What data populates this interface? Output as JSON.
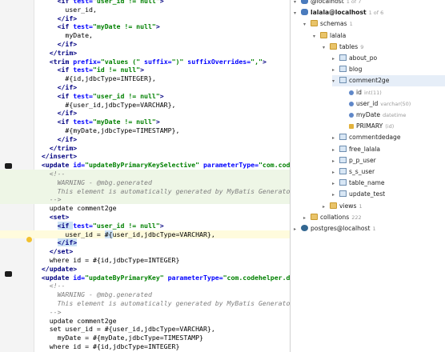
{
  "editor": {
    "lines": [
      {
        "n": "",
        "parts": [
          [
            "      ",
            ""
          ],
          [
            "<if ",
            "t"
          ],
          [
            "test=",
            "a"
          ],
          [
            "\"user_id != null\"",
            "v"
          ],
          [
            ">",
            "t"
          ]
        ]
      },
      {
        "n": "",
        "parts": [
          [
            "        user_id,",
            ""
          ]
        ]
      },
      {
        "n": "",
        "parts": [
          [
            "      ",
            ""
          ],
          [
            "</if>",
            "t"
          ]
        ]
      },
      {
        "n": "",
        "parts": [
          [
            "      ",
            ""
          ],
          [
            "<if ",
            "t"
          ],
          [
            "test=",
            "a"
          ],
          [
            "\"myDate != null\"",
            "v"
          ],
          [
            ">",
            "t"
          ]
        ]
      },
      {
        "n": "",
        "parts": [
          [
            "        myDate,",
            ""
          ]
        ]
      },
      {
        "n": "",
        "parts": [
          [
            "      ",
            ""
          ],
          [
            "</if>",
            "t"
          ]
        ]
      },
      {
        "n": "",
        "parts": [
          [
            "    ",
            ""
          ],
          [
            "</trim>",
            "t"
          ]
        ]
      },
      {
        "n": "",
        "parts": [
          [
            "    ",
            ""
          ],
          [
            "<trim ",
            "t"
          ],
          [
            "prefix=",
            "a"
          ],
          [
            "\"values (\" ",
            "v"
          ],
          [
            "suffix=",
            "a"
          ],
          [
            "\")\" ",
            "v"
          ],
          [
            "suffixOverrides=",
            "a"
          ],
          [
            "\",\"",
            "v"
          ],
          [
            ">",
            "t"
          ]
        ]
      },
      {
        "n": "",
        "parts": [
          [
            "      ",
            ""
          ],
          [
            "<if ",
            "t"
          ],
          [
            "test=",
            "a"
          ],
          [
            "\"id != null\"",
            "v"
          ],
          [
            ">",
            "t"
          ]
        ]
      },
      {
        "n": "",
        "parts": [
          [
            "        #{id,jdbcType=INTEGER},",
            ""
          ]
        ]
      },
      {
        "n": "",
        "parts": [
          [
            "      ",
            ""
          ],
          [
            "</if>",
            "t"
          ]
        ]
      },
      {
        "n": "",
        "parts": [
          [
            "      ",
            ""
          ],
          [
            "<if ",
            "t"
          ],
          [
            "test=",
            "a"
          ],
          [
            "\"user_id != null\"",
            "v"
          ],
          [
            ">",
            "t"
          ]
        ]
      },
      {
        "n": "",
        "parts": [
          [
            "        #{user_id,jdbcType=VARCHAR},",
            ""
          ]
        ]
      },
      {
        "n": "",
        "parts": [
          [
            "      ",
            ""
          ],
          [
            "</if>",
            "t"
          ]
        ]
      },
      {
        "n": "",
        "parts": [
          [
            "      ",
            ""
          ],
          [
            "<if ",
            "t"
          ],
          [
            "test=",
            "a"
          ],
          [
            "\"myDate != null\"",
            "v"
          ],
          [
            ">",
            "t"
          ]
        ]
      },
      {
        "n": "",
        "parts": [
          [
            "        #{myDate,jdbcType=TIMESTAMP},",
            ""
          ]
        ]
      },
      {
        "n": "",
        "parts": [
          [
            "      ",
            ""
          ],
          [
            "</if>",
            "t"
          ]
        ]
      },
      {
        "n": "",
        "parts": [
          [
            "    ",
            ""
          ],
          [
            "</trim>",
            "t"
          ]
        ]
      },
      {
        "n": "",
        "parts": [
          [
            "  ",
            ""
          ],
          [
            "</insert>",
            "t"
          ]
        ]
      },
      {
        "n": "",
        "parts": [
          [
            "  ",
            ""
          ],
          [
            "<update ",
            "t"
          ],
          [
            "id=",
            "a"
          ],
          [
            "\"updateByPrimaryKeySelective\" ",
            "v"
          ],
          [
            "parameterType=",
            "a"
          ],
          [
            "\"com.codehe",
            "v"
          ]
        ]
      },
      {
        "n": "",
        "hl": "green",
        "parts": [
          [
            "    ",
            ""
          ],
          [
            "<!--",
            "c"
          ]
        ]
      },
      {
        "n": "",
        "hl": "green",
        "parts": [
          [
            "      WARNING - @mbg.generated",
            "c"
          ]
        ]
      },
      {
        "n": "",
        "hl": "green",
        "parts": [
          [
            "      This element is automatically generated by MyBatis Generator,",
            "c"
          ]
        ]
      },
      {
        "n": "",
        "hl": "green",
        "parts": [
          [
            "    -->",
            "c"
          ]
        ]
      },
      {
        "n": "",
        "parts": [
          [
            "    update comment2ge",
            ""
          ]
        ]
      },
      {
        "n": "",
        "parts": [
          [
            "    ",
            ""
          ],
          [
            "<set>",
            "t"
          ]
        ]
      },
      {
        "n": "",
        "parts": [
          [
            "      ",
            ""
          ],
          [
            "<if ",
            "t sel"
          ],
          [
            "test=",
            "a"
          ],
          [
            "\"user_id != null\"",
            "v"
          ],
          [
            ">",
            "t"
          ]
        ]
      },
      {
        "n": "",
        "hl": "yellow",
        "parts": [
          [
            "        user_id = ",
            ""
          ],
          [
            "#{",
            "sel"
          ],
          [
            "user_id,jdbcType=VARCHAR}",
            ""
          ],
          [
            ",",
            ""
          ]
        ]
      },
      {
        "n": "",
        "parts": [
          [
            "      ",
            ""
          ],
          [
            "</if>",
            "t sel"
          ]
        ]
      },
      {
        "n": "",
        "parts": [
          [
            "    ",
            ""
          ],
          [
            "</set>",
            "t"
          ]
        ]
      },
      {
        "n": "",
        "parts": [
          [
            "    where id = #{id,jdbcType=INTEGER}",
            ""
          ]
        ]
      },
      {
        "n": "",
        "parts": [
          [
            "  ",
            ""
          ],
          [
            "</update>",
            "t"
          ]
        ]
      },
      {
        "n": "",
        "parts": [
          [
            "  ",
            ""
          ],
          [
            "<update ",
            "t"
          ],
          [
            "id=",
            "a"
          ],
          [
            "\"updateByPrimaryKey\" ",
            "v"
          ],
          [
            "parameterType=",
            "a"
          ],
          [
            "\"com.codehelper.dom",
            "v"
          ]
        ]
      },
      {
        "n": "",
        "parts": [
          [
            "    ",
            ""
          ],
          [
            "<!--",
            "c"
          ]
        ]
      },
      {
        "n": "",
        "parts": [
          [
            "      WARNING - @mbg.generated",
            "c"
          ]
        ]
      },
      {
        "n": "",
        "parts": [
          [
            "      This element is automatically generated by MyBatis Generator,",
            "c"
          ]
        ]
      },
      {
        "n": "",
        "parts": [
          [
            "    -->",
            "c"
          ]
        ]
      },
      {
        "n": "",
        "parts": [
          [
            "    update comment2ge",
            ""
          ]
        ]
      },
      {
        "n": "",
        "parts": [
          [
            "    set user_id = #{user_id,jdbcType=VARCHAR},",
            ""
          ]
        ]
      },
      {
        "n": "",
        "parts": [
          [
            "      myDate = #{myDate,jdbcType=TIMESTAMP}",
            ""
          ]
        ]
      },
      {
        "n": "",
        "parts": [
          [
            "    where id = #{id,jdbcType=INTEGER}",
            ""
          ]
        ]
      },
      {
        "n": "",
        "parts": [
          [
            "  ",
            ""
          ],
          [
            "</update>",
            "t"
          ]
        ]
      }
    ]
  },
  "db_tree": {
    "nodes": [
      {
        "indent": 0,
        "arrow": "▾",
        "icon": "dbico",
        "label": "@localhost",
        "meta": "1 of 7"
      },
      {
        "indent": 0,
        "arrow": "▾",
        "icon": "dbico",
        "label": "lalala@localhost",
        "meta": "1 of 6",
        "bold": true
      },
      {
        "indent": 1,
        "arrow": "▾",
        "icon": "folder",
        "label": "schemas",
        "meta": "1"
      },
      {
        "indent": 2,
        "arrow": "▾",
        "icon": "folder",
        "label": "lalala",
        "meta": ""
      },
      {
        "indent": 3,
        "arrow": "▾",
        "icon": "folder",
        "label": "tables",
        "meta": "9"
      },
      {
        "indent": 4,
        "arrow": "▸",
        "icon": "table",
        "label": "about_po",
        "meta": ""
      },
      {
        "indent": 4,
        "arrow": "▸",
        "icon": "table",
        "label": "blog",
        "meta": ""
      },
      {
        "indent": 4,
        "arrow": "▾",
        "icon": "table",
        "label": "comment2ge",
        "meta": "",
        "sel": true
      },
      {
        "indent": 5,
        "arrow": "",
        "icon": "col",
        "label": "id",
        "meta": "int(11)"
      },
      {
        "indent": 5,
        "arrow": "",
        "icon": "col",
        "label": "user_id",
        "meta": "varchar(50)"
      },
      {
        "indent": 5,
        "arrow": "",
        "icon": "col",
        "label": "myDate",
        "meta": "datetime"
      },
      {
        "indent": 5,
        "arrow": "",
        "icon": "key",
        "label": "PRIMARY",
        "meta": "(id)"
      },
      {
        "indent": 4,
        "arrow": "▸",
        "icon": "table",
        "label": "commentdedage",
        "meta": ""
      },
      {
        "indent": 4,
        "arrow": "▸",
        "icon": "table",
        "label": "free_lalala",
        "meta": ""
      },
      {
        "indent": 4,
        "arrow": "▸",
        "icon": "table",
        "label": "p_p_user",
        "meta": ""
      },
      {
        "indent": 4,
        "arrow": "▸",
        "icon": "table",
        "label": "s_s_user",
        "meta": ""
      },
      {
        "indent": 4,
        "arrow": "▸",
        "icon": "table",
        "label": "table_name",
        "meta": ""
      },
      {
        "indent": 4,
        "arrow": "▸",
        "icon": "table",
        "label": "update_test",
        "meta": ""
      },
      {
        "indent": 3,
        "arrow": "▸",
        "icon": "folder",
        "label": "views",
        "meta": "1"
      },
      {
        "indent": 1,
        "arrow": "▸",
        "icon": "folder",
        "label": "collations",
        "meta": "222"
      },
      {
        "indent": 0,
        "arrow": "▸",
        "icon": "pg",
        "label": "postgres@localhost",
        "meta": "1"
      }
    ]
  }
}
